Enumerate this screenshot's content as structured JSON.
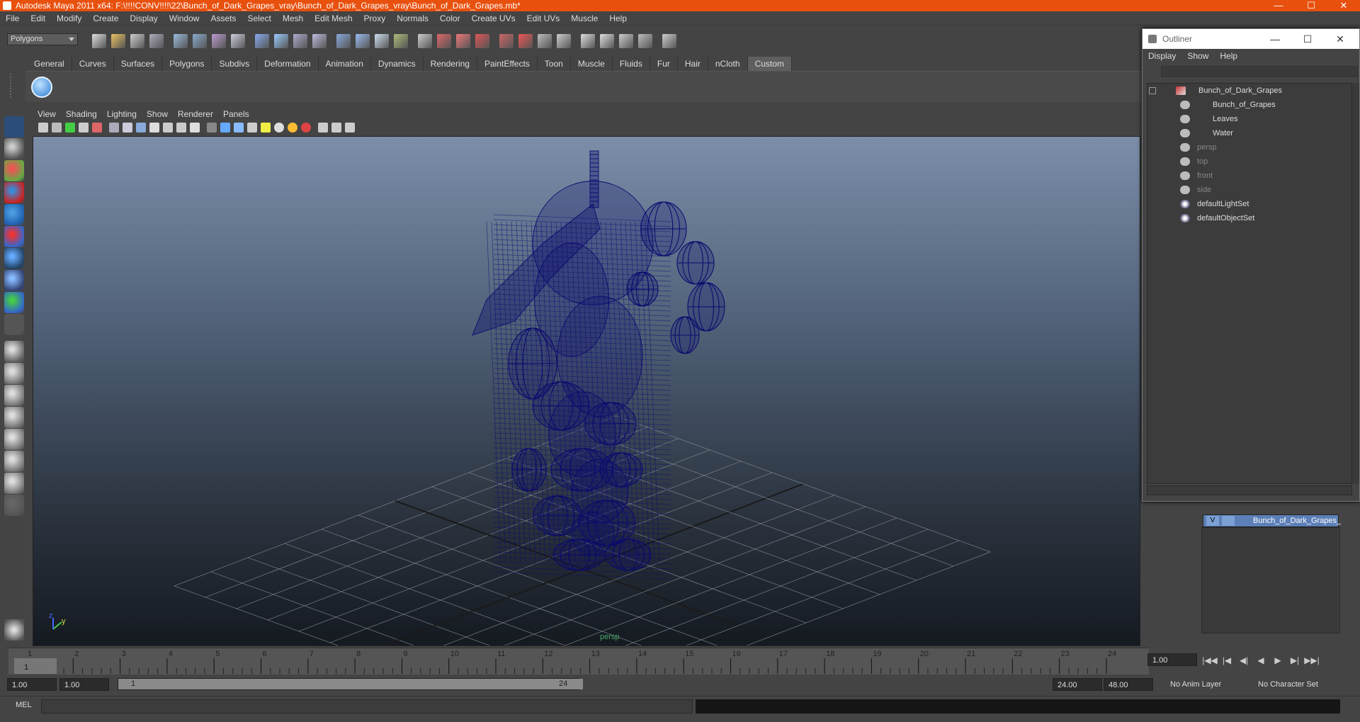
{
  "window": {
    "title": "Autodesk Maya 2011 x64: F:\\!!!!CONV!!!!\\22\\Bunch_of_Dark_Grapes_vray\\Bunch_of_Dark_Grapes_vray\\Bunch_of_Dark_Grapes.mb*",
    "minimize": "—",
    "maximize": "☐",
    "close": "✕"
  },
  "menus": [
    "File",
    "Edit",
    "Modify",
    "Create",
    "Display",
    "Window",
    "Assets",
    "Select",
    "Mesh",
    "Edit Mesh",
    "Proxy",
    "Normals",
    "Color",
    "Create UVs",
    "Edit UVs",
    "Muscle",
    "Help"
  ],
  "mode_select": "Polygons",
  "shelf_tabs": [
    "General",
    "Curves",
    "Surfaces",
    "Polygons",
    "Subdivs",
    "Deformation",
    "Animation",
    "Dynamics",
    "Rendering",
    "PaintEffects",
    "Toon",
    "Muscle",
    "Fluids",
    "Fur",
    "Hair",
    "nCloth",
    "Custom"
  ],
  "active_shelf_tab": "Custom",
  "panel_menus": [
    "View",
    "Shading",
    "Lighting",
    "Show",
    "Renderer",
    "Panels"
  ],
  "viewport": {
    "axis_y": "y",
    "axis_z": "z",
    "camera_label": "persp"
  },
  "timeline": {
    "ticks": [
      "1",
      "2",
      "3",
      "4",
      "5",
      "6",
      "7",
      "8",
      "9",
      "10",
      "11",
      "12",
      "13",
      "14",
      "15",
      "16",
      "17",
      "18",
      "19",
      "20",
      "21",
      "22",
      "23",
      "24"
    ],
    "current_frame": "1.00",
    "playhead": "1"
  },
  "playback_icons": [
    "|◀◀",
    "|◀",
    "◀|",
    "◀",
    "▶",
    "▶|",
    "▶▶|"
  ],
  "range": {
    "start": "1.00",
    "playback_start": "1.00",
    "slider_start": "1",
    "slider_end": "24",
    "playback_end": "24.00",
    "end": "48.00",
    "anim_layer": "No Anim Layer",
    "char_set": "No Character Set"
  },
  "cmdline": {
    "label": "MEL"
  },
  "outliner": {
    "title": "Outliner",
    "menus": [
      "Display",
      "Show",
      "Help"
    ],
    "items": [
      {
        "label": "Bunch_of_Dark_Grapes",
        "dim": false
      },
      {
        "label": "Bunch_of_Grapes",
        "dim": false
      },
      {
        "label": "Leaves",
        "dim": false
      },
      {
        "label": "Water",
        "dim": false
      },
      {
        "label": "persp",
        "dim": true
      },
      {
        "label": "top",
        "dim": true
      },
      {
        "label": "front",
        "dim": true
      },
      {
        "label": "side",
        "dim": true
      },
      {
        "label": "defaultLightSet",
        "dim": false
      },
      {
        "label": "defaultObjectSet",
        "dim": false
      }
    ]
  },
  "layer": {
    "visible": "V",
    "name": "Bunch_of_Dark_Grapes_"
  },
  "colors": {
    "title_bar": "#e8500e",
    "wireframe": "#0a0a6e",
    "layer_highlight": "#5c7fb7"
  }
}
